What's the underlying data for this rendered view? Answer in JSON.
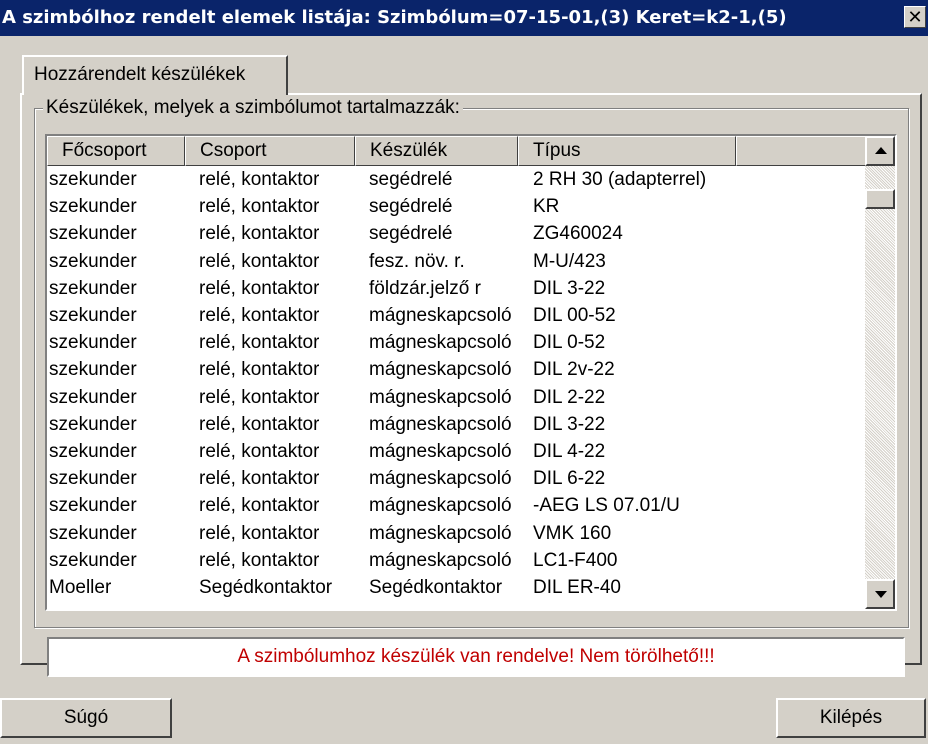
{
  "window": {
    "title": "A szimbólhoz rendelt elemek listája: Szimbólum=07-15-01,(3) Keret=k2-1,(5)",
    "close_label": "✕"
  },
  "tabs": [
    {
      "label": "Hozzárendelt készülékek"
    }
  ],
  "groupbox": {
    "label": "Készülékek, melyek a szimbólumot tartalmazzák:"
  },
  "table": {
    "columns": [
      "Főcsoport",
      "Csoport",
      "Készülék",
      "Típus"
    ],
    "rows": [
      [
        "szekunder",
        "relé, kontaktor",
        "segédrelé",
        "2 RH 30 (adapterrel)"
      ],
      [
        "szekunder",
        "relé, kontaktor",
        "segédrelé",
        "KR"
      ],
      [
        "szekunder",
        "relé, kontaktor",
        "segédrelé",
        "ZG460024"
      ],
      [
        "szekunder",
        "relé, kontaktor",
        "fesz. növ. r.",
        "M-U/423"
      ],
      [
        "szekunder",
        "relé, kontaktor",
        "földzár.jelző r",
        "DIL 3-22"
      ],
      [
        "szekunder",
        "relé, kontaktor",
        "mágneskapcsoló",
        "DIL 00-52"
      ],
      [
        "szekunder",
        "relé, kontaktor",
        "mágneskapcsoló",
        "DIL 0-52"
      ],
      [
        "szekunder",
        "relé, kontaktor",
        "mágneskapcsoló",
        "DIL 2v-22"
      ],
      [
        "szekunder",
        "relé, kontaktor",
        "mágneskapcsoló",
        "DIL 2-22"
      ],
      [
        "szekunder",
        "relé, kontaktor",
        "mágneskapcsoló",
        "DIL 3-22"
      ],
      [
        "szekunder",
        "relé, kontaktor",
        "mágneskapcsoló",
        "DIL 4-22"
      ],
      [
        "szekunder",
        "relé, kontaktor",
        "mágneskapcsoló",
        "DIL 6-22"
      ],
      [
        "szekunder",
        "relé, kontaktor",
        "mágneskapcsoló",
        "-AEG LS 07.01/U"
      ],
      [
        "szekunder",
        "relé, kontaktor",
        "mágneskapcsoló",
        "VMK 160"
      ],
      [
        "szekunder",
        "relé, kontaktor",
        "mágneskapcsoló",
        "LC1-F400"
      ],
      [
        "Moeller",
        "Segédkontaktor",
        "Segédkontaktor",
        "DIL ER-40"
      ]
    ]
  },
  "status": {
    "message": "A szimbólumhoz készülék van rendelve! Nem törölhető!!!",
    "color": "#c00000"
  },
  "buttons": {
    "help": "Súgó",
    "exit": "Kilépés"
  },
  "colors": {
    "title_bar": "#0a246a",
    "window_bg": "#d4d0c8"
  }
}
